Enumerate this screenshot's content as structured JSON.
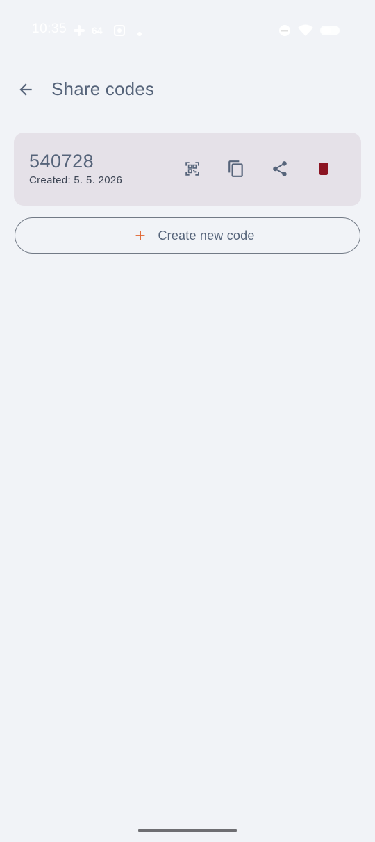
{
  "status_bar": {
    "time": "10:35",
    "icons": [
      "slack-icon",
      "signal-icon",
      "screen-record-icon",
      "dot-icon",
      "dnd-icon",
      "wifi-icon",
      "battery-icon"
    ],
    "icon_color": "#ffffff"
  },
  "app_bar": {
    "back_icon": "arrow-left-icon",
    "title": "Share codes"
  },
  "codes": [
    {
      "code": "540728",
      "created": "Created: 5. 5. 2026",
      "actions": [
        "qr-code-icon",
        "copy-icon",
        "share-icon",
        "delete-icon"
      ]
    }
  ],
  "create_button": {
    "icon": "plus-icon",
    "label": "Create new code"
  },
  "colors": {
    "background": "#f1f3f7",
    "card": "#e5e1e8",
    "text_primary": "#56647a",
    "accent": "#e0622d",
    "delete": "#8b1422"
  }
}
